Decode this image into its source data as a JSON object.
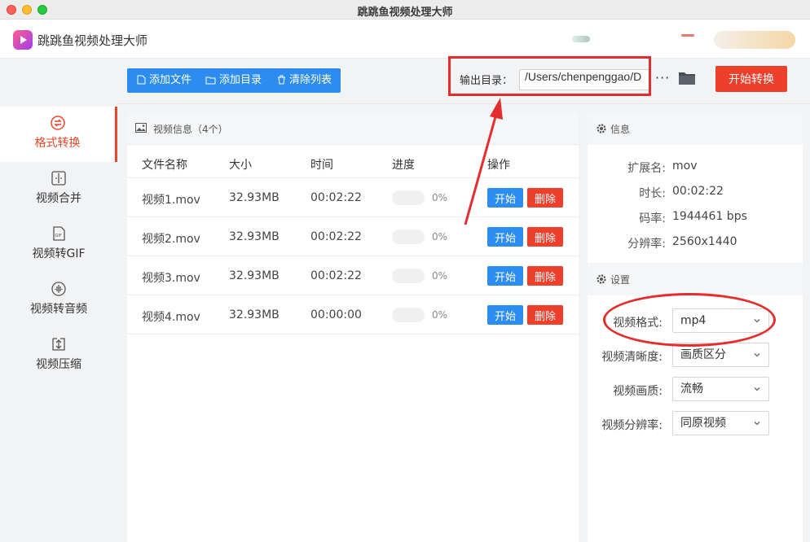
{
  "window": {
    "title": "跳跳鱼视频处理大师"
  },
  "app": {
    "name": "跳跳鱼视频处理大师"
  },
  "sidebar": {
    "items": [
      {
        "label": "格式转换",
        "icon": "format-convert-icon",
        "active": true
      },
      {
        "label": "视频合并",
        "icon": "video-merge-icon",
        "active": false
      },
      {
        "label": "视频转GIF",
        "icon": "gif-icon",
        "active": false
      },
      {
        "label": "视频转音频",
        "icon": "audio-icon",
        "active": false
      },
      {
        "label": "视频压缩",
        "icon": "compress-icon",
        "active": false
      }
    ]
  },
  "toolbar": {
    "add_file": "添加文件",
    "add_folder": "添加目录",
    "clear_list": "清除列表",
    "output_label": "输出目录：",
    "output_path": "/Users/chenpenggao/D",
    "more": "···",
    "start_convert": "开始转换"
  },
  "file_panel": {
    "title": "视频信息（4个）",
    "columns": {
      "name": "文件名称",
      "size": "大小",
      "time": "时间",
      "progress": "进度",
      "actions": "操作"
    },
    "start_label": "开始",
    "delete_label": "删除",
    "rows": [
      {
        "name": "视频1.mov",
        "size": "32.93MB",
        "time": "00:02:22",
        "progress": 0,
        "progress_text": "0%"
      },
      {
        "name": "视频2.mov",
        "size": "32.93MB",
        "time": "00:02:22",
        "progress": 0,
        "progress_text": "0%"
      },
      {
        "name": "视频3.mov",
        "size": "32.93MB",
        "time": "00:02:22",
        "progress": 0,
        "progress_text": "0%"
      },
      {
        "name": "视频4.mov",
        "size": "32.93MB",
        "time": "00:00:00",
        "progress": 0,
        "progress_text": "0%"
      }
    ]
  },
  "info_panel": {
    "title": "信息",
    "fields": [
      {
        "label": "扩展名:",
        "value": "mov"
      },
      {
        "label": "时长:",
        "value": "00:02:22"
      },
      {
        "label": "码率:",
        "value": "1944461 bps"
      },
      {
        "label": "分辨率:",
        "value": "2560x1440"
      }
    ]
  },
  "settings_panel": {
    "title": "设置",
    "fields": [
      {
        "label": "视频格式:",
        "value": "mp4"
      },
      {
        "label": "视频清晰度:",
        "value": "画质区分"
      },
      {
        "label": "视频画质:",
        "value": "流畅"
      },
      {
        "label": "视频分辨率:",
        "value": "同原视频"
      }
    ]
  },
  "colors": {
    "accent_blue": "#2d8cf0",
    "accent_red": "#ee3f2b",
    "annotation_red": "#e52d2d"
  }
}
